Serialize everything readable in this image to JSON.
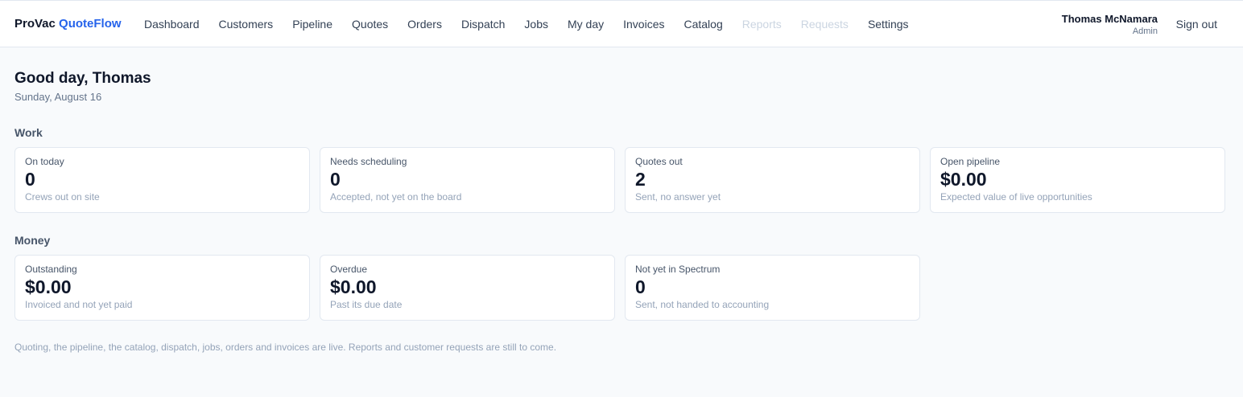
{
  "header": {
    "brand_part1": "ProVac",
    "brand_part2": "QuoteFlow",
    "nav": [
      {
        "label": "Dashboard",
        "enabled": true
      },
      {
        "label": "Customers",
        "enabled": true
      },
      {
        "label": "Pipeline",
        "enabled": true
      },
      {
        "label": "Quotes",
        "enabled": true
      },
      {
        "label": "Orders",
        "enabled": true
      },
      {
        "label": "Dispatch",
        "enabled": true
      },
      {
        "label": "Jobs",
        "enabled": true
      },
      {
        "label": "My day",
        "enabled": true
      },
      {
        "label": "Invoices",
        "enabled": true
      },
      {
        "label": "Catalog",
        "enabled": true
      },
      {
        "label": "Reports",
        "enabled": false
      },
      {
        "label": "Requests",
        "enabled": false
      },
      {
        "label": "Settings",
        "enabled": true
      }
    ],
    "user_name": "Thomas McNamara",
    "user_role": "Admin",
    "signout_label": "Sign out"
  },
  "greeting": "Good day, Thomas",
  "date": "Sunday, August 16",
  "work": {
    "label": "Work",
    "cards": [
      {
        "label": "On today",
        "value": "0",
        "sub": "Crews out on site"
      },
      {
        "label": "Needs scheduling",
        "value": "0",
        "sub": "Accepted, not yet on the board"
      },
      {
        "label": "Quotes out",
        "value": "2",
        "sub": "Sent, no answer yet"
      },
      {
        "label": "Open pipeline",
        "value": "$0.00",
        "sub": "Expected value of live opportunities"
      }
    ]
  },
  "money": {
    "label": "Money",
    "cards": [
      {
        "label": "Outstanding",
        "value": "$0.00",
        "sub": "Invoiced and not yet paid"
      },
      {
        "label": "Overdue",
        "value": "$0.00",
        "sub": "Past its due date"
      },
      {
        "label": "Not yet in Spectrum",
        "value": "0",
        "sub": "Sent, not handed to accounting"
      }
    ]
  },
  "footnote": "Quoting, the pipeline, the catalog, dispatch, jobs, orders and invoices are live. Reports and customer requests are still to come.",
  "colors": {
    "accent": "#2563eb",
    "background": "#f8fafc",
    "card_border": "#e2e8f0",
    "disabled_nav": "#cbd5e1"
  }
}
